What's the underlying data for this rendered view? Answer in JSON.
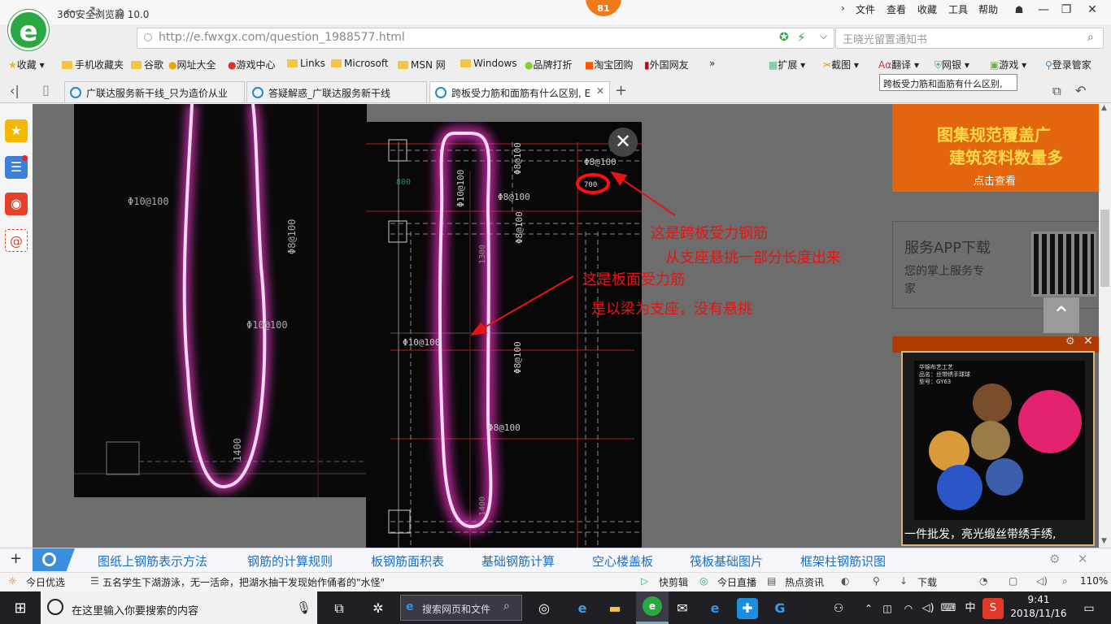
{
  "window": {
    "title": "360安全浏览器 10.0",
    "badge": "81",
    "logo_glyph": "e"
  },
  "menu": [
    "文件",
    "查看",
    "收藏",
    "工具",
    "帮助"
  ],
  "window_buttons": {
    "min": "—",
    "max": "❐",
    "close": "✕"
  },
  "nav": {
    "back": "←",
    "refresh": "↻",
    "home": "⌂"
  },
  "address": {
    "value": "http://e.fwxgx.com/question_1988577.html"
  },
  "search": {
    "value": "王晓光留置通知书",
    "icon": "search-icon"
  },
  "bookmarks": [
    "收藏",
    "手机收藏夹",
    "谷歌",
    "网址大全",
    "游戏中心",
    "Links",
    "Microsoft",
    "MSN 网",
    "Windows",
    "品牌打折",
    "淘宝团购",
    "外国网友"
  ],
  "toolbar": [
    "扩展",
    "截图",
    "翻译",
    "网银",
    "游戏",
    "登录管家"
  ],
  "tooltip": "跨板受力筋和面筋有什么区别,",
  "tabs": [
    {
      "label": "广联达服务新干线_只为造价从业"
    },
    {
      "label": "答疑解惑_广联达服务新干线"
    },
    {
      "label": "跨板受力筋和面筋有什么区别, E"
    }
  ],
  "tab_add": "+",
  "cad": {
    "left_labels": [
      "Φ10@100",
      "Φ8@100",
      "Φ10@100",
      "1400"
    ],
    "main_labels": [
      "Φ8@100",
      "Φ8@100",
      "Φ8@100",
      "Φ10@100",
      "Φ8@100",
      "Φ8@100",
      "Φ10@100",
      "Φ8@100",
      "800",
      "1300",
      "1400",
      "700"
    ]
  },
  "annotations": [
    "这是跨板受力钢筋",
    "从支座悬挑一部分长度出来",
    "这是板面受力筋",
    "是以梁为支座，没有悬挑"
  ],
  "ads": {
    "top_line1": "图集规范覆盖广",
    "top_line2": "建筑资料数量多",
    "top_cta": "点击查看",
    "app_title": "服务APP下载",
    "app_sub1": "您的掌上服务专",
    "app_sub2": "家",
    "video_title": "一件批发，亮光缎丝带绣手绣,",
    "video_label": "华锦布艺工艺\n品名：丝带绣手球球\n型号：GY63"
  },
  "related_links": [
    "图纸上钢筋表示方法",
    "钢筋的计算规则",
    "板钢筋面积表",
    "基础钢筋计算",
    "空心楼盖板",
    "筏板基础图片",
    "框架柱钢筋识图"
  ],
  "status": {
    "left": "今日优选",
    "news": "五名学生下湖游泳，无一活命，把湖水抽干发现始作俑者的\"水怪\"",
    "items": [
      "快剪辑",
      "今日直播",
      "热点资讯",
      "下载"
    ],
    "zoom": "110%"
  },
  "taskbar": {
    "search_placeholder": "在这里输入你要搜索的内容",
    "search_box": "搜索网页和文件",
    "ime": "中",
    "time": "9:41",
    "date": "2018/11/16"
  }
}
